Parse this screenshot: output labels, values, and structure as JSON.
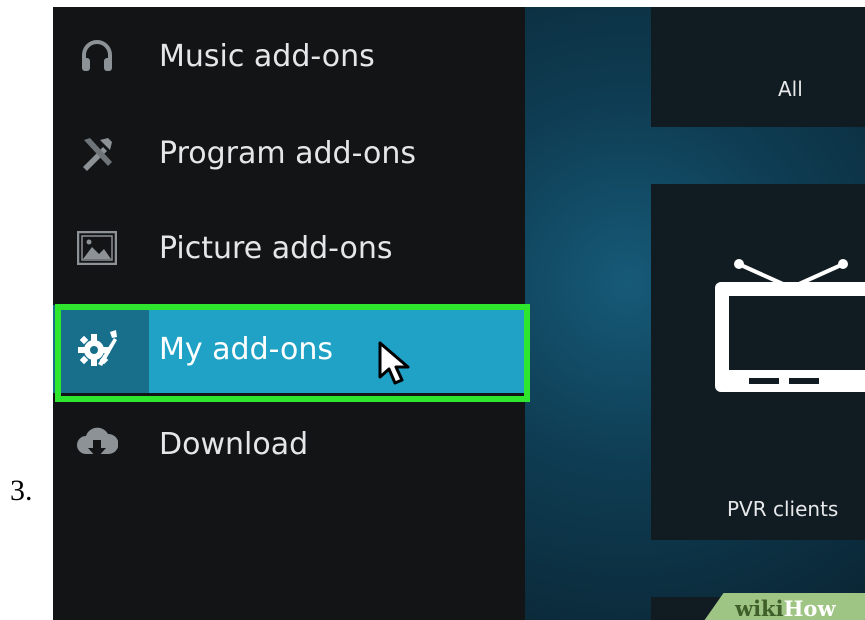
{
  "step": "3.",
  "sidebar": {
    "items": [
      {
        "label": "Music add-ons",
        "icon": "headphones-icon"
      },
      {
        "label": "Program add-ons",
        "icon": "program-tools-icon"
      },
      {
        "label": "Picture add-ons",
        "icon": "picture-icon"
      },
      {
        "label": "My add-ons",
        "icon": "gear-wrench-icon",
        "selected": true
      },
      {
        "label": "Download",
        "icon": "cloud-download-icon"
      }
    ]
  },
  "main": {
    "tiles": [
      {
        "label": "All"
      },
      {
        "label": "PVR clients",
        "icon": "tv-icon"
      }
    ]
  },
  "watermark": {
    "part1": "wiki",
    "part2": "How"
  },
  "colors": {
    "sidebar_bg": "#121416",
    "selected_bg": "#1fa2c6",
    "highlight_border": "#2ee62e",
    "watermark_bg": "#9fc585"
  }
}
